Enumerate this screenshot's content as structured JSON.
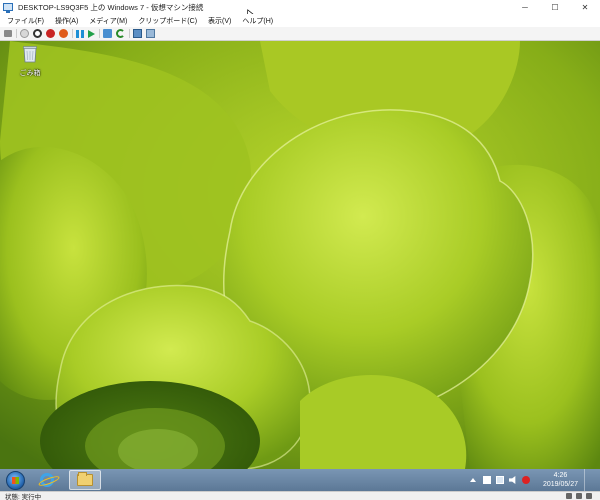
{
  "window": {
    "title": "DESKTOP-LS9Q3F5 上の Windows 7 - 仮想マシン接続",
    "controls": {
      "minimize": "─",
      "maximize": "☐",
      "close": "✕"
    }
  },
  "menu": {
    "items": [
      "ファイル(F)",
      "操作(A)",
      "メディア(M)",
      "クリップボード(C)",
      "表示(V)",
      "ヘルプ(H)"
    ]
  },
  "toolbar": {
    "buttons": [
      "ctrl-alt-del-icon",
      "start-icon",
      "turn-off-icon",
      "stop-icon",
      "shutdown-icon",
      "reset-icon",
      "pause-icon",
      "resume-icon",
      "checkpoint-icon",
      "revert-icon",
      "enhanced-session-icon",
      "share-icon"
    ]
  },
  "desktop": {
    "recycle_bin_label": "ごみ箱",
    "wallpaper_colors": {
      "leaf_light": "#c3e03a",
      "leaf_mid": "#9dc41f",
      "leaf_dark": "#5e8a12",
      "shadow": "#3d6a0c"
    }
  },
  "taskbar": {
    "apps": [
      "start-orb",
      "internet-explorer-icon",
      "explorer-folder-icon"
    ],
    "clock_time": "4:26",
    "clock_date": "2019/05/27",
    "tray": [
      "show-hidden-icon",
      "action-center-flag-icon",
      "network-icon",
      "volume-icon",
      "no-audio-icon"
    ]
  },
  "status": {
    "text": "状態: 実行中"
  }
}
